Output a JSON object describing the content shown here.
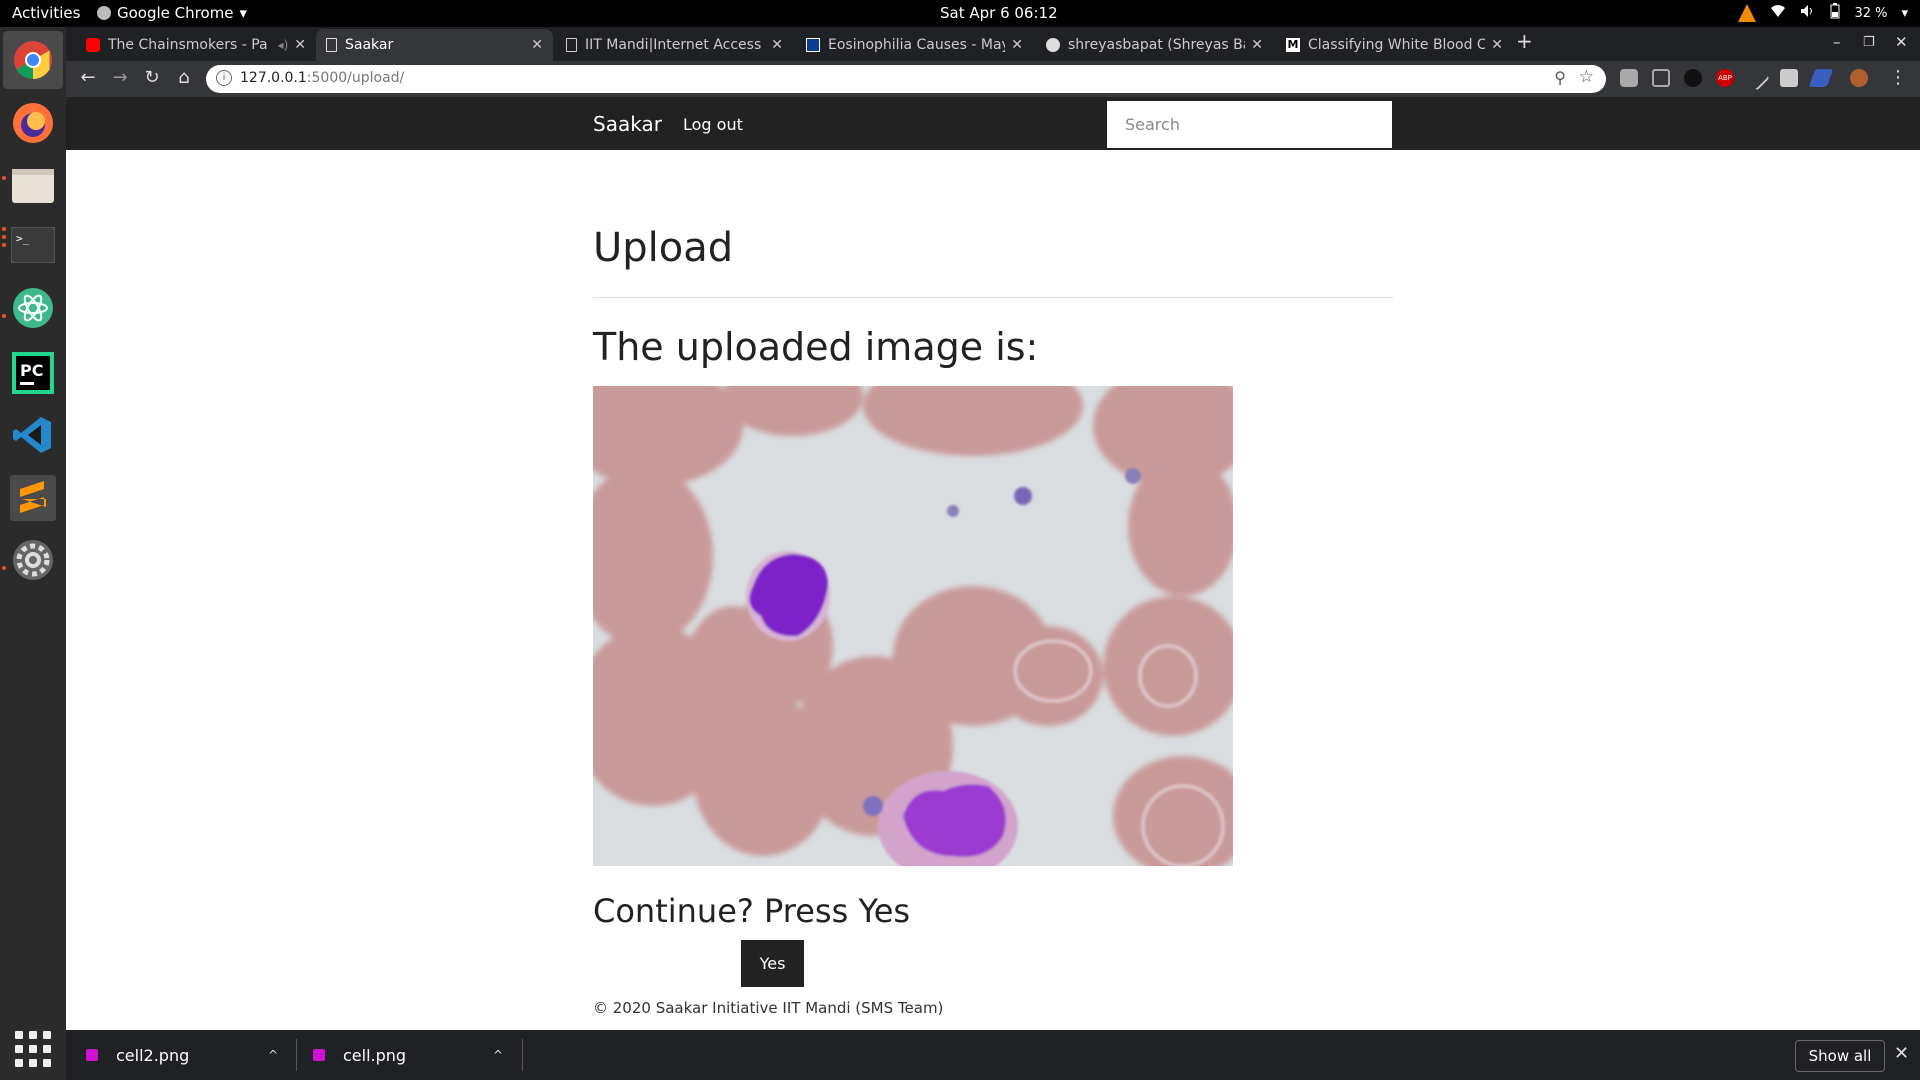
{
  "system": {
    "activities": "Activities",
    "app_name": "Google Chrome",
    "clock": "Sat Apr 6  06:12",
    "battery": "32 %"
  },
  "browser": {
    "tabs": [
      {
        "title": "The Chainsmokers - Pa",
        "favicon": "youtube-icon"
      },
      {
        "title": "Saakar",
        "favicon": "page-icon",
        "active": true
      },
      {
        "title": "IIT Mandi|Internet Access",
        "favicon": "page-icon"
      },
      {
        "title": "Eosinophilia Causes - May",
        "favicon": "mayo-icon"
      },
      {
        "title": "shreyasbapat (Shreyas Ba",
        "favicon": "github-icon"
      },
      {
        "title": "Classifying White Blood C",
        "favicon": "medium-icon"
      }
    ],
    "url_host": "127.0.0.1",
    "url_path": ":5000/upload/"
  },
  "navbar": {
    "brand": "Saakar",
    "logout": "Log out",
    "search_placeholder": "Search"
  },
  "main": {
    "title": "Upload",
    "subtitle": "The uploaded image is:",
    "prompt": "Continue? Press Yes",
    "yes_label": "Yes",
    "footer": "© 2020 Saakar Initiative IIT Mandi (SMS Team)"
  },
  "downloads": {
    "items": [
      {
        "name": "cell2.png"
      },
      {
        "name": "cell.png"
      }
    ],
    "show_all": "Show all"
  },
  "colors": {
    "navbar_bg": "#222222",
    "button_bg": "#222222",
    "chrome_dark": "#202124"
  }
}
